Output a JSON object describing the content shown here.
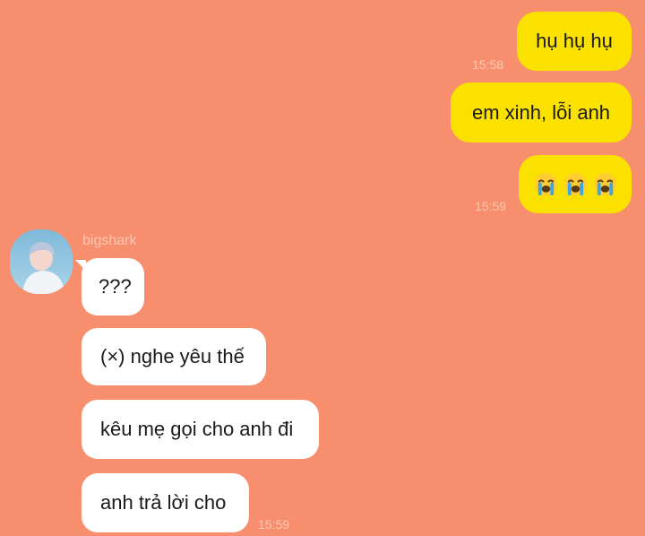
{
  "conversation": {
    "sent_messages": [
      {
        "text": "hụ hụ hụ",
        "time": "15:58"
      },
      {
        "text": "em xinh, lỗi anh",
        "time": ""
      },
      {
        "emojis": [
          "loudly-crying-face",
          "loudly-crying-face",
          "loudly-crying-face"
        ],
        "time": "15:59"
      }
    ],
    "contact": {
      "name": "bigshark",
      "avatar": "person-avatar"
    },
    "received_messages": [
      {
        "text": "???"
      },
      {
        "text": "(×) nghe yêu thế"
      },
      {
        "text": "kêu mẹ gọi cho anh đi"
      },
      {
        "text": "anh trả lời cho",
        "time": "15:59"
      }
    ]
  },
  "colors": {
    "background": "#F78F6E",
    "sent_bubble": "#FAE100",
    "received_bubble": "#FFFFFF",
    "timestamp": "#FBC8B4"
  }
}
